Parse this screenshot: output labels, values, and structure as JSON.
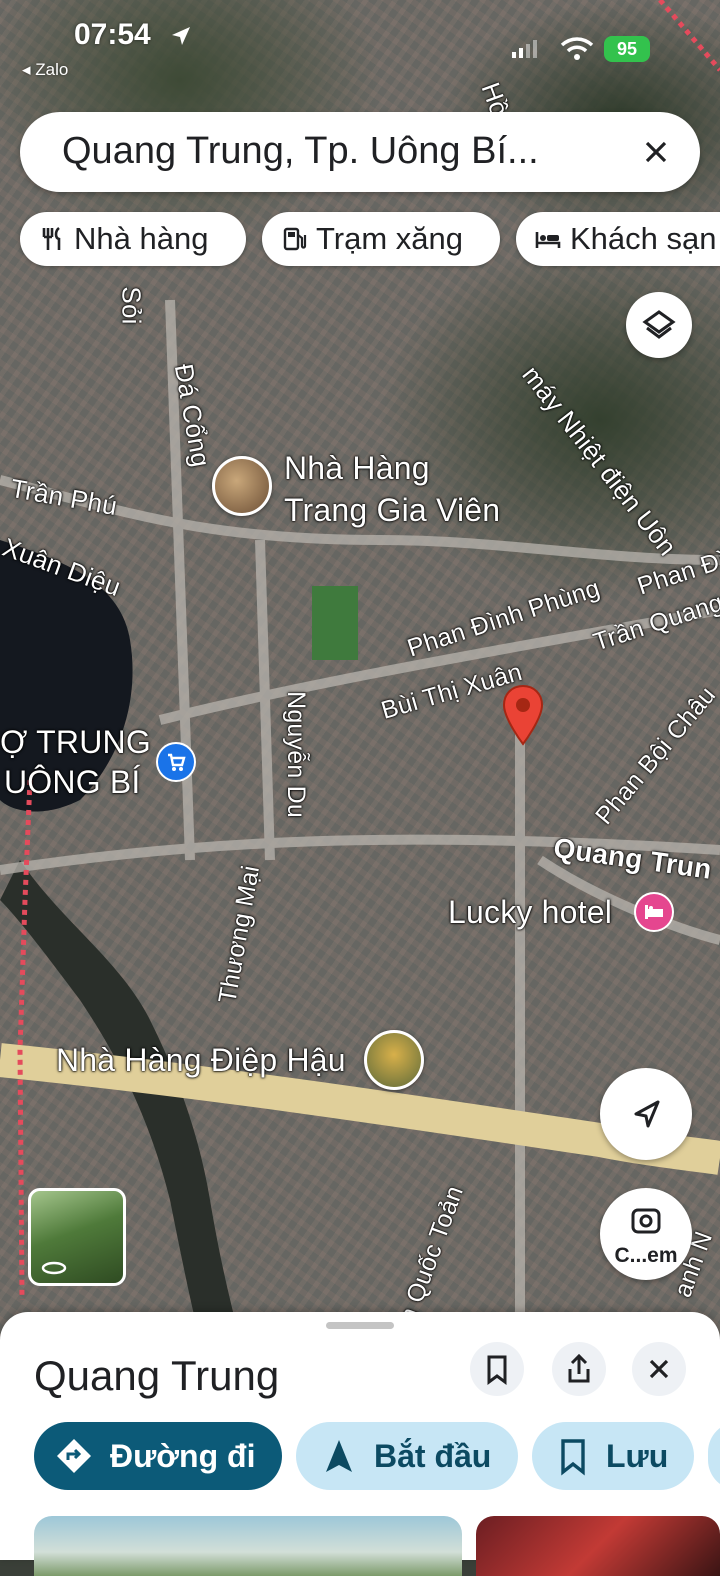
{
  "status_bar": {
    "time": "07:54",
    "back_app": "◂ Zalo",
    "battery": "95"
  },
  "search": {
    "query": "Quang Trung, Tp. Uông Bí..."
  },
  "filter_chips": [
    {
      "label": "Nhà hàng",
      "icon": "restaurant-icon"
    },
    {
      "label": "Trạm xăng",
      "icon": "gas-station-icon"
    },
    {
      "label": "Khách sạn",
      "icon": "hotel-icon"
    }
  ],
  "map": {
    "labels": {
      "soi": "Sỏi",
      "da_cong": "Đá Cổng",
      "tran_phu": "Trần Phú",
      "xuan_dieu": "Xuân Diệu",
      "nha_hang_trang_line1": "Nhà Hàng",
      "nha_hang_trang_line2": "Trang Gia Viên",
      "nhiet_dien": "máy Nhiệt điện Uôn",
      "ho": "Hồ",
      "phan_dinh_phung": "Phan Đình Phùng",
      "phan_di": "Phan Đì",
      "tran_quang": "Trần Quang",
      "bui_thi_xuan": "Bùi Thị Xuân",
      "cho_line1": "Ợ TRUNG",
      "cho_line2": "UÔNG BÍ",
      "nguyen_du": "Nguyễn Du",
      "phan_boi_chau": "Phan Bội Châu",
      "quang_trung": "Quang Trun",
      "lucky_hotel": "Lucky hotel",
      "thuong_mai": "Thương Mại",
      "nha_hang_diep_hau": "Nhà Hàng Điệp Hậu",
      "quoc_toan": "n Quốc Toản",
      "nh_n": "anh N"
    },
    "street_view_icon": "rotate-360-icon",
    "layers_icon": "layers-icon",
    "location_icon": "navigation-arrow-icon",
    "lens_label": "C...em"
  },
  "sheet": {
    "title": "Quang Trung",
    "actions": [
      {
        "label": "Đường đi",
        "icon": "directions-icon"
      },
      {
        "label": "Bắt đầu",
        "icon": "navigation-icon"
      },
      {
        "label": "Lưu",
        "icon": "bookmark-icon"
      }
    ]
  },
  "colors": {
    "primary_button": "#0b57d0",
    "primary_dark": "#0c5a78",
    "tonal_button": "#c7e6f5",
    "pin_red": "#ea4335",
    "battery_green": "#33c24d"
  }
}
